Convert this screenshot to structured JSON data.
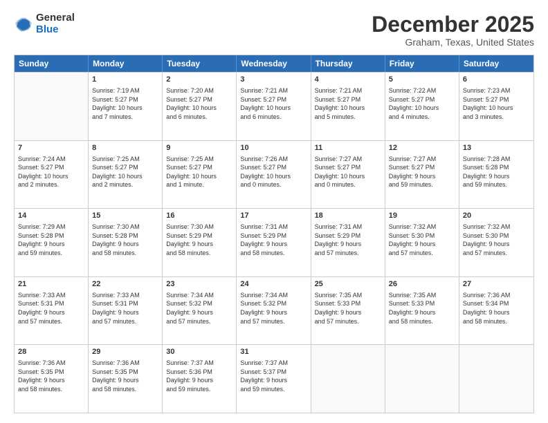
{
  "logo": {
    "general": "General",
    "blue": "Blue"
  },
  "title": "December 2025",
  "location": "Graham, Texas, United States",
  "days_header": [
    "Sunday",
    "Monday",
    "Tuesday",
    "Wednesday",
    "Thursday",
    "Friday",
    "Saturday"
  ],
  "weeks": [
    [
      {
        "num": "",
        "info": ""
      },
      {
        "num": "1",
        "info": "Sunrise: 7:19 AM\nSunset: 5:27 PM\nDaylight: 10 hours\nand 7 minutes."
      },
      {
        "num": "2",
        "info": "Sunrise: 7:20 AM\nSunset: 5:27 PM\nDaylight: 10 hours\nand 6 minutes."
      },
      {
        "num": "3",
        "info": "Sunrise: 7:21 AM\nSunset: 5:27 PM\nDaylight: 10 hours\nand 6 minutes."
      },
      {
        "num": "4",
        "info": "Sunrise: 7:21 AM\nSunset: 5:27 PM\nDaylight: 10 hours\nand 5 minutes."
      },
      {
        "num": "5",
        "info": "Sunrise: 7:22 AM\nSunset: 5:27 PM\nDaylight: 10 hours\nand 4 minutes."
      },
      {
        "num": "6",
        "info": "Sunrise: 7:23 AM\nSunset: 5:27 PM\nDaylight: 10 hours\nand 3 minutes."
      }
    ],
    [
      {
        "num": "7",
        "info": "Sunrise: 7:24 AM\nSunset: 5:27 PM\nDaylight: 10 hours\nand 2 minutes."
      },
      {
        "num": "8",
        "info": "Sunrise: 7:25 AM\nSunset: 5:27 PM\nDaylight: 10 hours\nand 2 minutes."
      },
      {
        "num": "9",
        "info": "Sunrise: 7:25 AM\nSunset: 5:27 PM\nDaylight: 10 hours\nand 1 minute."
      },
      {
        "num": "10",
        "info": "Sunrise: 7:26 AM\nSunset: 5:27 PM\nDaylight: 10 hours\nand 0 minutes."
      },
      {
        "num": "11",
        "info": "Sunrise: 7:27 AM\nSunset: 5:27 PM\nDaylight: 10 hours\nand 0 minutes."
      },
      {
        "num": "12",
        "info": "Sunrise: 7:27 AM\nSunset: 5:27 PM\nDaylight: 9 hours\nand 59 minutes."
      },
      {
        "num": "13",
        "info": "Sunrise: 7:28 AM\nSunset: 5:28 PM\nDaylight: 9 hours\nand 59 minutes."
      }
    ],
    [
      {
        "num": "14",
        "info": "Sunrise: 7:29 AM\nSunset: 5:28 PM\nDaylight: 9 hours\nand 59 minutes."
      },
      {
        "num": "15",
        "info": "Sunrise: 7:30 AM\nSunset: 5:28 PM\nDaylight: 9 hours\nand 58 minutes."
      },
      {
        "num": "16",
        "info": "Sunrise: 7:30 AM\nSunset: 5:29 PM\nDaylight: 9 hours\nand 58 minutes."
      },
      {
        "num": "17",
        "info": "Sunrise: 7:31 AM\nSunset: 5:29 PM\nDaylight: 9 hours\nand 58 minutes."
      },
      {
        "num": "18",
        "info": "Sunrise: 7:31 AM\nSunset: 5:29 PM\nDaylight: 9 hours\nand 57 minutes."
      },
      {
        "num": "19",
        "info": "Sunrise: 7:32 AM\nSunset: 5:30 PM\nDaylight: 9 hours\nand 57 minutes."
      },
      {
        "num": "20",
        "info": "Sunrise: 7:32 AM\nSunset: 5:30 PM\nDaylight: 9 hours\nand 57 minutes."
      }
    ],
    [
      {
        "num": "21",
        "info": "Sunrise: 7:33 AM\nSunset: 5:31 PM\nDaylight: 9 hours\nand 57 minutes."
      },
      {
        "num": "22",
        "info": "Sunrise: 7:33 AM\nSunset: 5:31 PM\nDaylight: 9 hours\nand 57 minutes."
      },
      {
        "num": "23",
        "info": "Sunrise: 7:34 AM\nSunset: 5:32 PM\nDaylight: 9 hours\nand 57 minutes."
      },
      {
        "num": "24",
        "info": "Sunrise: 7:34 AM\nSunset: 5:32 PM\nDaylight: 9 hours\nand 57 minutes."
      },
      {
        "num": "25",
        "info": "Sunrise: 7:35 AM\nSunset: 5:33 PM\nDaylight: 9 hours\nand 57 minutes."
      },
      {
        "num": "26",
        "info": "Sunrise: 7:35 AM\nSunset: 5:33 PM\nDaylight: 9 hours\nand 58 minutes."
      },
      {
        "num": "27",
        "info": "Sunrise: 7:36 AM\nSunset: 5:34 PM\nDaylight: 9 hours\nand 58 minutes."
      }
    ],
    [
      {
        "num": "28",
        "info": "Sunrise: 7:36 AM\nSunset: 5:35 PM\nDaylight: 9 hours\nand 58 minutes."
      },
      {
        "num": "29",
        "info": "Sunrise: 7:36 AM\nSunset: 5:35 PM\nDaylight: 9 hours\nand 58 minutes."
      },
      {
        "num": "30",
        "info": "Sunrise: 7:37 AM\nSunset: 5:36 PM\nDaylight: 9 hours\nand 59 minutes."
      },
      {
        "num": "31",
        "info": "Sunrise: 7:37 AM\nSunset: 5:37 PM\nDaylight: 9 hours\nand 59 minutes."
      },
      {
        "num": "",
        "info": ""
      },
      {
        "num": "",
        "info": ""
      },
      {
        "num": "",
        "info": ""
      }
    ]
  ]
}
